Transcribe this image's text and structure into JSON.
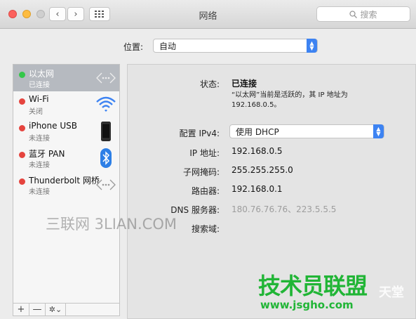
{
  "window": {
    "title": "网络"
  },
  "toolbar": {
    "back": "‹",
    "forward": "›",
    "grid": "⠿",
    "search_placeholder": "搜索"
  },
  "location": {
    "label": "位置:",
    "value": "自动"
  },
  "services": [
    {
      "name": "以太网",
      "status": "已连接",
      "dot": "#34c749",
      "icon": "ethernet-icon"
    },
    {
      "name": "Wi-Fi",
      "status": "关闭",
      "dot": "#e5443e",
      "icon": "wifi-icon"
    },
    {
      "name": "iPhone USB",
      "status": "未连接",
      "dot": "#e5443e",
      "icon": "iphone-icon"
    },
    {
      "name": "蓝牙 PAN",
      "status": "未连接",
      "dot": "#e5443e",
      "icon": "bluetooth-icon"
    },
    {
      "name": "Thunderbolt 网桥",
      "status": "未连接",
      "dot": "#e5443e",
      "icon": "ethernet-icon"
    }
  ],
  "sidebar_buttons": {
    "add": "+",
    "remove": "—",
    "gear": "✲⌄"
  },
  "details": {
    "status_label": "状态:",
    "status_value": "已连接",
    "status_note": "“以太网”当前是活跃的，其 IP 地址为 192.168.0.5。",
    "configure_label": "配置 IPv4:",
    "configure_value": "使用 DHCP",
    "ip_label": "IP 地址:",
    "ip_value": "192.168.0.5",
    "mask_label": "子网掩码:",
    "mask_value": "255.255.255.0",
    "router_label": "路由器:",
    "router_value": "192.168.0.1",
    "dns_label": "DNS 服务器:",
    "dns_value": "180.76.76.76、223.5.5.5",
    "search_label": "搜索域:"
  },
  "watermarks": {
    "left": "三联网 3LIAN.COM",
    "right_main": "技术员联盟",
    "right_url": "www.jsgho.com",
    "right_small": "天堂"
  },
  "colors": {
    "accent": "#3d83f2",
    "selected": "#b6bac0",
    "connected": "#34c749",
    "disconnected": "#e5443e",
    "watermark_green": "#21b536"
  }
}
